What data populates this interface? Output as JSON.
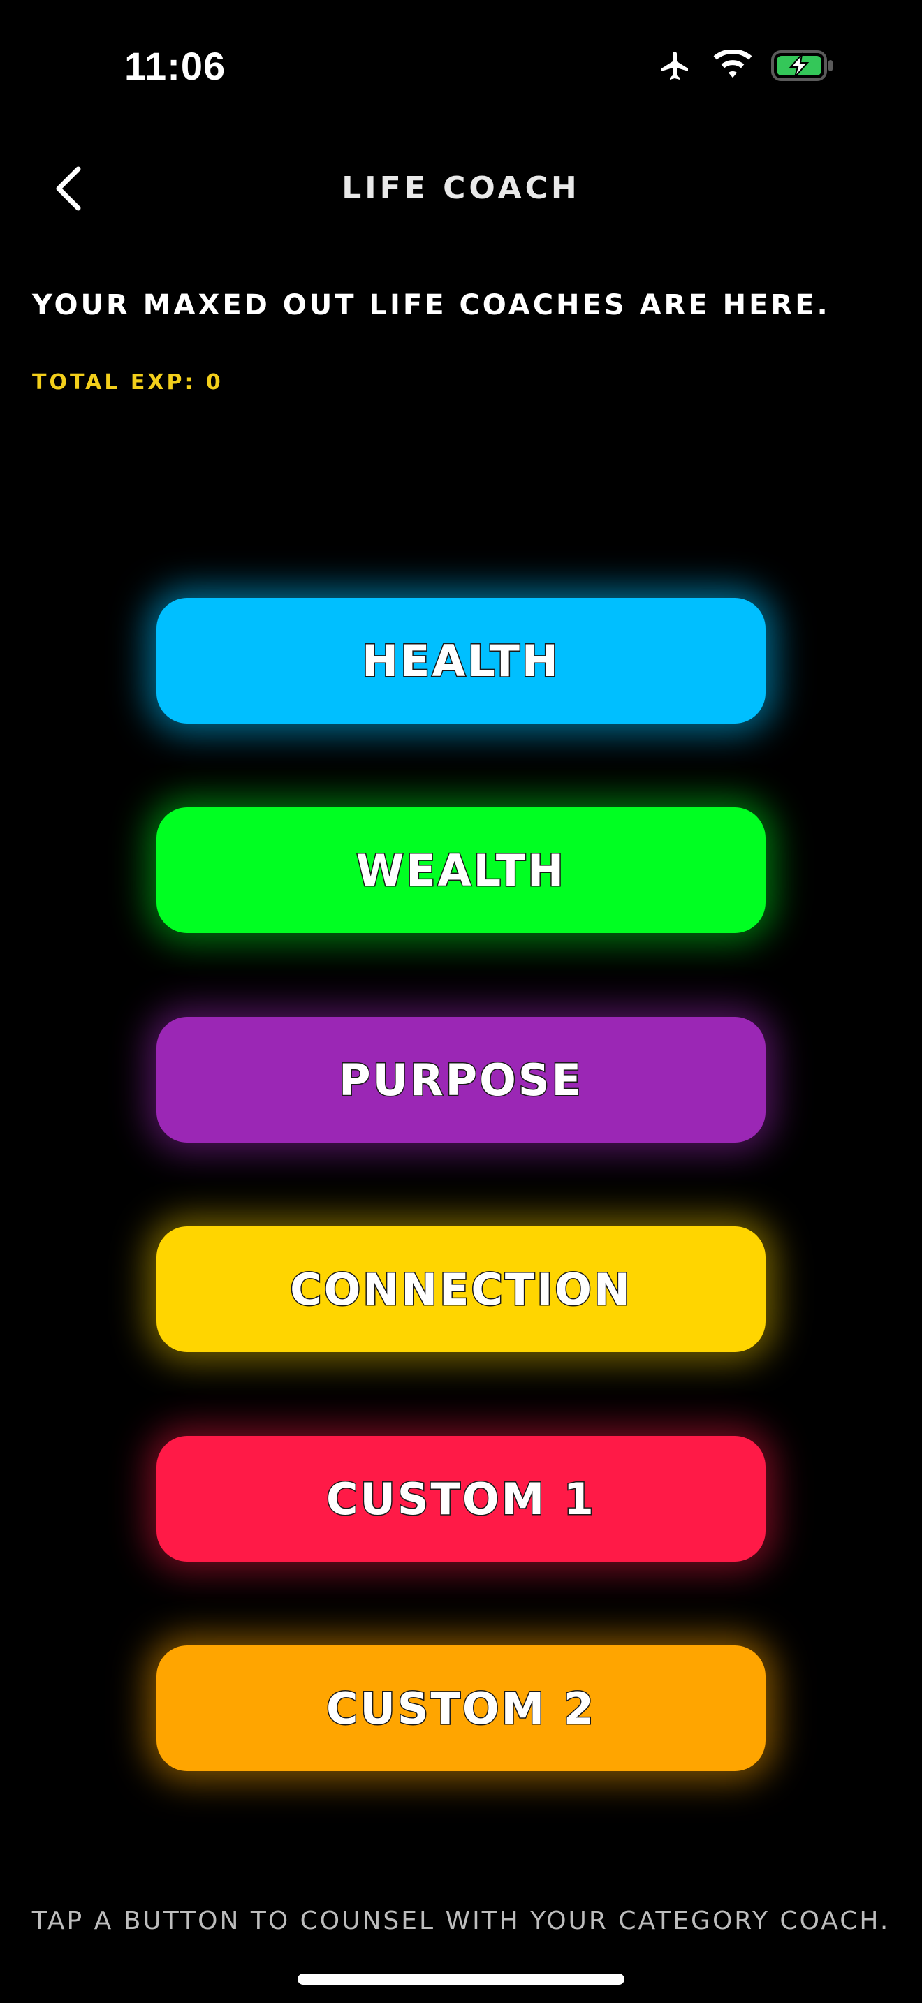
{
  "status_bar": {
    "time": "11:06",
    "icons": [
      "airplane-icon",
      "wifi-icon",
      "battery-charging-icon"
    ],
    "battery_color": "#34c759"
  },
  "header": {
    "back_icon": "chevron-left-icon",
    "title": "LIFE COACH"
  },
  "intro": {
    "subtitle": "YOUR MAXED OUT LIFE COACHES ARE HERE.",
    "total_exp": "TOTAL EXP: 0",
    "total_exp_color": "#f3cf1b"
  },
  "coaches": [
    {
      "label": "HEALTH",
      "color": "#00bfff"
    },
    {
      "label": "WEALTH",
      "color": "#00ff22"
    },
    {
      "label": "PURPOSE",
      "color": "#9b27b5"
    },
    {
      "label": "CONNECTION",
      "color": "#ffd500"
    },
    {
      "label": "CUSTOM 1",
      "color": "#ff1a47"
    },
    {
      "label": "CUSTOM 2",
      "color": "#ffa500"
    }
  ],
  "footer": {
    "hint": "TAP A BUTTON TO COUNSEL WITH YOUR CATEGORY COACH."
  }
}
